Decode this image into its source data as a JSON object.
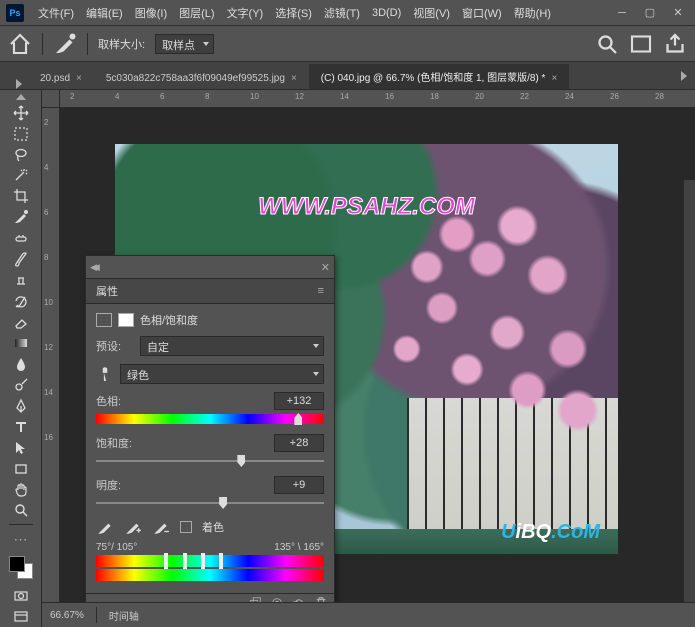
{
  "app": {
    "logo": "Ps"
  },
  "menu": [
    "文件(F)",
    "编辑(E)",
    "图像(I)",
    "图层(L)",
    "文字(Y)",
    "选择(S)",
    "滤镜(T)",
    "3D(D)",
    "视图(V)",
    "窗口(W)",
    "帮助(H)"
  ],
  "options": {
    "sample_size_label": "取样大小:",
    "sample_size_value": "取样点"
  },
  "tabs": [
    {
      "label": "20.psd",
      "active": false
    },
    {
      "label": "5c030a822c758aa3f6f09049ef99525.jpg",
      "active": false
    },
    {
      "label": "(C) 040.jpg @ 66.7% (色相/饱和度 1, 图层蒙版/8) *",
      "active": true
    }
  ],
  "ruler_h": [
    "2",
    "4",
    "6",
    "8",
    "10",
    "12",
    "14",
    "16",
    "18",
    "20",
    "22",
    "24",
    "26",
    "28"
  ],
  "ruler_v": [
    "2",
    "4",
    "6",
    "8",
    "10",
    "12",
    "14",
    "16"
  ],
  "watermark1": "WWW.PSAHZ.COM",
  "watermark2_pre": "U",
  "watermark2_mid": "iBQ",
  "watermark2_post": ".CoM",
  "panel": {
    "title": "属性",
    "adj_name": "色相/饱和度",
    "preset_label": "预设:",
    "preset_value": "自定",
    "channel_value": "绿色",
    "hue_label": "色相:",
    "hue_value": "+132",
    "sat_label": "饱和度:",
    "sat_value": "+28",
    "light_label": "明度:",
    "light_value": "+9",
    "colorize_label": "着色",
    "range_left": "75°/ 105°",
    "range_right": "135° \\ 165°"
  },
  "status": {
    "zoom": "66.67%",
    "timeline": "时间轴"
  }
}
